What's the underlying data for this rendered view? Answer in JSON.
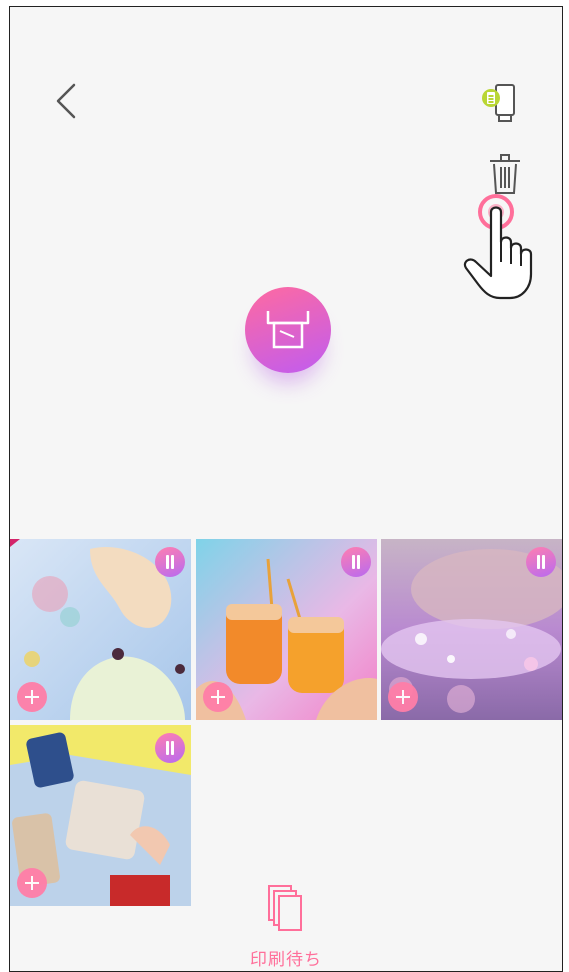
{
  "header": {
    "back_icon": "chevron-left-icon",
    "battery_icon": "printer-battery-icon",
    "delete_icon": "trash-icon"
  },
  "main": {
    "print_button_icon": "printer-icon"
  },
  "queue": {
    "items": [
      {
        "name": "photo-1",
        "status": "paused"
      },
      {
        "name": "photo-2",
        "status": "paused"
      },
      {
        "name": "photo-3",
        "status": "paused"
      },
      {
        "name": "photo-4",
        "status": "paused"
      }
    ]
  },
  "footer": {
    "queue_label": "印刷待ち",
    "queue_icon": "stacked-pages-icon"
  },
  "colors": {
    "accent": "#ff6f9a",
    "gradient_start": "#ff6aa0",
    "gradient_end": "#c05cf0",
    "battery_indicator": "#b9d634",
    "background": "#f6f6f6"
  }
}
